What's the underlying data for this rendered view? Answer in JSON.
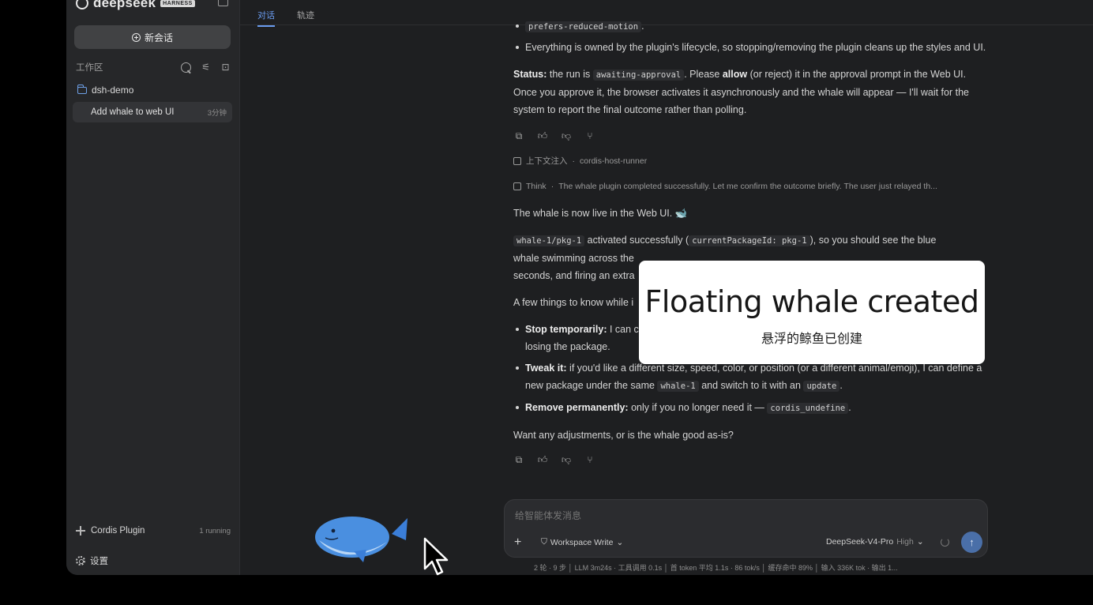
{
  "sidebar": {
    "brand_name": "deepseek",
    "brand_badge": "HARNESS",
    "new_chat_label": "新会话",
    "workspace_title": "工作区",
    "project_name": "dsh-demo",
    "session": {
      "name": "Add whale to web UI",
      "time": "3分钟"
    },
    "plugin": {
      "name": "Cordis Plugin",
      "status": "1 running"
    },
    "settings_label": "设置"
  },
  "tabs": [
    {
      "label": "对话",
      "active": true
    },
    {
      "label": "轨迹",
      "active": false
    }
  ],
  "message1": {
    "top_code": "prefers-reduced-motion",
    "top_code_suffix": ".",
    "bullet_lifecycle": "Everything is owned by the plugin's lifecycle, so stopping/removing the plugin cleans up the styles and UI.",
    "status_label": "Status:",
    "status_text_1": " the run is ",
    "status_code": "awaiting-approval",
    "status_text_2": ". Please ",
    "status_allow": "allow",
    "status_text_3": " (or reject) it in the approval prompt in the Web UI. Once you approve it, the browser activates it asynchronously and the whale will appear — I'll wait for the system to report the final outcome rather than polling."
  },
  "context_line": {
    "label": "上下文注入",
    "source": "cordis-host-runner"
  },
  "think_line": {
    "label": "Think",
    "text": "The whale plugin completed successfully. Let me confirm the outcome briefly. The user just relayed th..."
  },
  "message2": {
    "intro": "The whale is now live in the Web UI. 🐋",
    "code_pkg": "whale-1/pkg-1",
    "text_activated": " activated successfully (",
    "code_current": "currentPackageId: pkg-1",
    "text_after": "), so you should see the blue",
    "line2": "whale swimming across the",
    "line3": "seconds, and firing an extra",
    "things_intro": "A few things to know while i",
    "stop_label": "Stop temporarily:",
    "stop_text": " I can c",
    "stop_line2": "losing the package.",
    "tweak_label": "Tweak it:",
    "tweak_text_1": " if you'd like a different size, speed, color, or position (or a different animal/emoji), I can define a new package under the same ",
    "tweak_code_1": "whale-1",
    "tweak_text_2": " and switch to it with an ",
    "tweak_code_2": "update",
    "tweak_text_3": ".",
    "remove_label": "Remove permanently:",
    "remove_text": " only if you no longer need it — ",
    "remove_code": "cordis_undefine",
    "remove_text_2": ".",
    "question": "Want any adjustments, or is the whale good as-is?"
  },
  "actions": {
    "copy": "copy-icon",
    "like": "thumbs-up-icon",
    "dislike": "thumbs-down-icon",
    "branch": "branch-icon"
  },
  "composer": {
    "placeholder": "给智能体发消息",
    "mode": "Workspace Write",
    "model": "DeepSeek-V4-Pro",
    "effort": "High"
  },
  "status_bar": "2 轮 · 9 步 │ LLM 3m24s · 工具调用 0.1s │ 首 token 平均 1.1s · 86 tok/s │ 缓存命中 89% │ 输入 336K tok · 输出 1...",
  "toast": {
    "title": "Floating whale created",
    "subtitle": "悬浮的鲸鱼已创建"
  },
  "colors": {
    "accent": "#6a9cf0",
    "whale": "#4a8fe0",
    "background": "#1e1f21",
    "sidebar": "#262729"
  }
}
